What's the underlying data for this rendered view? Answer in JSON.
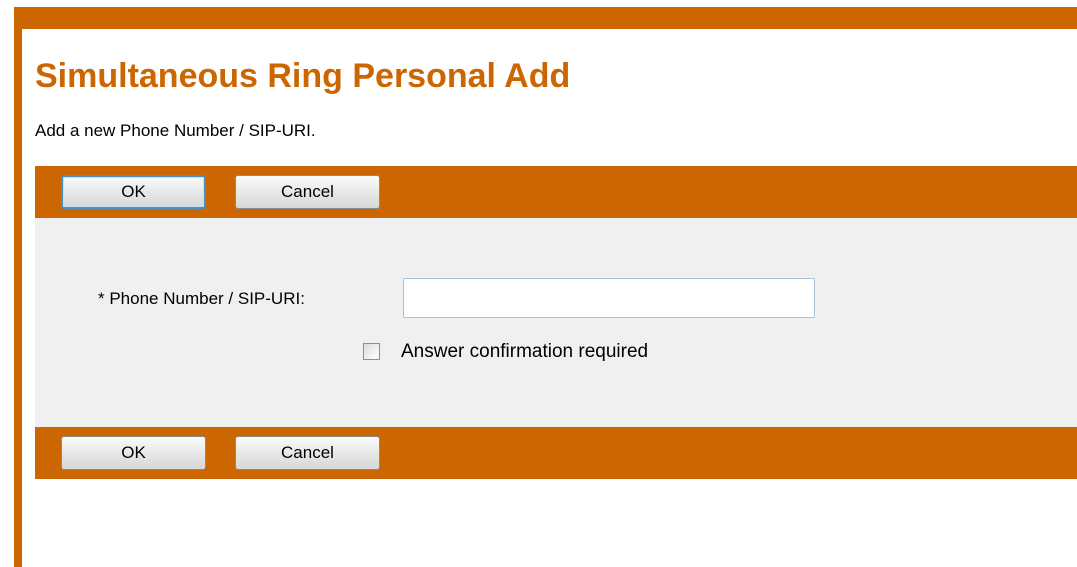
{
  "page": {
    "title": "Simultaneous Ring Personal Add",
    "subtitle": "Add a new Phone Number / SIP-URI."
  },
  "toolbar_top": {
    "ok_label": "OK",
    "cancel_label": "Cancel"
  },
  "toolbar_bottom": {
    "ok_label": "OK",
    "cancel_label": "Cancel"
  },
  "form": {
    "phone_label": "* Phone Number / SIP-URI:",
    "phone_value": "",
    "answer_confirmation_label": "Answer confirmation required",
    "answer_confirmation_checked": false
  },
  "colors": {
    "accent": "#cc6600",
    "form_background": "#f0f0f0"
  }
}
